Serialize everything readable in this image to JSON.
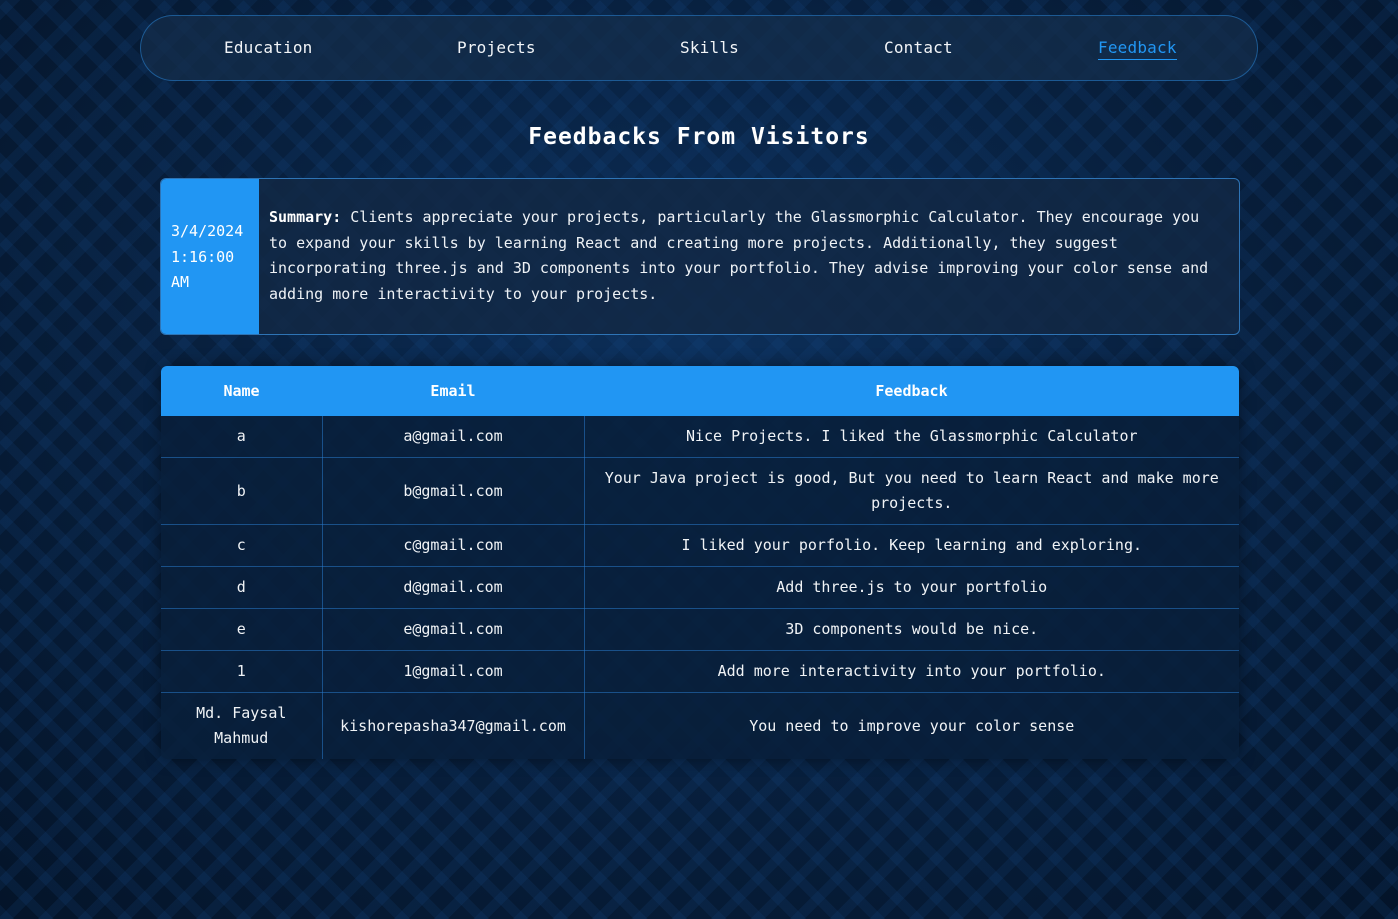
{
  "nav": {
    "items": [
      {
        "label": "Education"
      },
      {
        "label": "Projects"
      },
      {
        "label": "Skills"
      },
      {
        "label": "Contact"
      },
      {
        "label": "Feedback"
      }
    ],
    "active": "Feedback"
  },
  "page": {
    "title": "Feedbacks From Visitors"
  },
  "summary": {
    "date_line1": "3/4/2024",
    "date_line2": "1:16:00",
    "date_line3": "AM",
    "label": "Summary:",
    "text": " Clients appreciate your projects, particularly the Glassmorphic Calculator. They encourage you to expand your skills by learning React and creating more projects. Additionally, they suggest incorporating three.js and 3D components into your portfolio. They advise improving your color sense and adding more interactivity to your projects."
  },
  "table": {
    "headers": {
      "name": "Name",
      "email": "Email",
      "feedback": "Feedback"
    },
    "rows": [
      {
        "name": "a",
        "email": "a@gmail.com",
        "feedback": "Nice Projects. I liked the Glassmorphic Calculator"
      },
      {
        "name": "b",
        "email": "b@gmail.com",
        "feedback": "Your Java project is good, But you need to learn React and make more projects."
      },
      {
        "name": "c",
        "email": "c@gmail.com",
        "feedback": "I liked your porfolio. Keep learning and exploring."
      },
      {
        "name": "d",
        "email": "d@gmail.com",
        "feedback": "Add three.js to your portfolio"
      },
      {
        "name": "e",
        "email": "e@gmail.com",
        "feedback": "3D components would be nice."
      },
      {
        "name": "1",
        "email": "1@gmail.com",
        "feedback": "Add more interactivity into your portfolio."
      },
      {
        "name": "Md. Faysal Mahmud",
        "email": "kishorepasha347@gmail.com",
        "feedback": "You need to improve your color sense"
      }
    ]
  },
  "colors": {
    "accent": "#2196f3",
    "background": "#061a33"
  }
}
